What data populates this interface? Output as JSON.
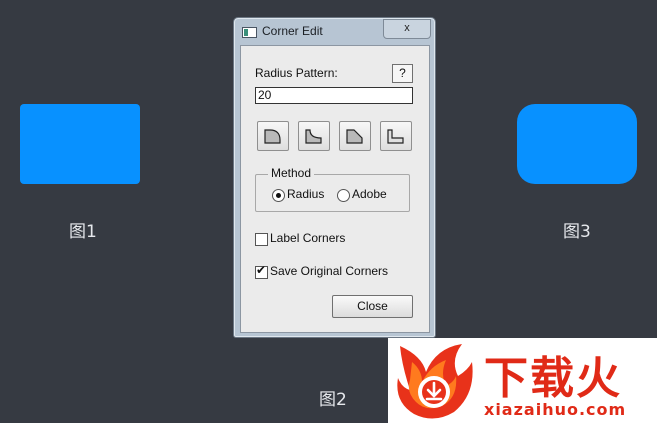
{
  "figures": {
    "fig1": "图1",
    "fig2": "图2",
    "fig3": "图3"
  },
  "colors": {
    "shape_fill": "#0891ff",
    "background": "#363a42",
    "watermark_red": "#e02a17"
  },
  "dialog": {
    "title": "Corner Edit",
    "close_x": "x",
    "radius_pattern_label": "Radius Pattern:",
    "help_label": "?",
    "radius_value": "20",
    "corner_shape_buttons": [
      "rounded-corner-icon",
      "inverted-rounded-corner-icon",
      "chamfer-corner-icon",
      "inset-corner-icon"
    ],
    "method": {
      "legend": "Method",
      "options": [
        "Radius",
        "Adobe"
      ],
      "selected": "Radius"
    },
    "label_corners": {
      "label": "Label Corners",
      "checked": false
    },
    "save_original": {
      "label": "Save Original Corners",
      "checked": true
    },
    "close_button": "Close"
  },
  "watermark": {
    "title": "下载火",
    "url": "xiazaihuo.com"
  }
}
